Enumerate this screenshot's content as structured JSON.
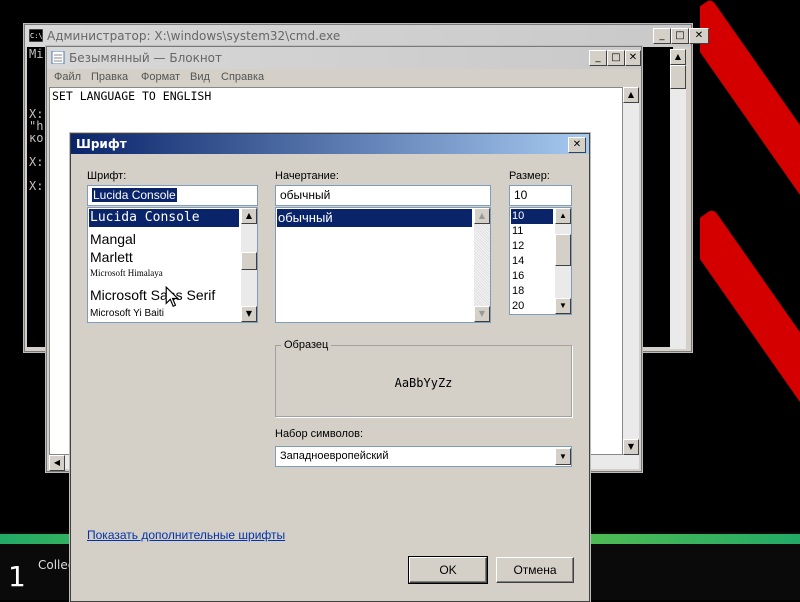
{
  "cmd": {
    "title": "Администратор: X:\\windows\\system32\\cmd.exe",
    "lines": [
      "Mi",
      "X:",
      "\"h",
      "ко",
      "X:",
      "X:"
    ]
  },
  "notepad": {
    "title": "Безымянный — Блокнот",
    "menu": [
      "Файл",
      "Правка",
      "Формат",
      "Вид",
      "Справка"
    ],
    "text": "SET LANGUAGE TO ENGLISH"
  },
  "dialog": {
    "title": "Шрифт",
    "font_label": "Шрифт:",
    "font_value": "Lucida Console",
    "fonts": [
      "Lucida Console",
      "Mangal",
      "Marlett",
      "Microsoft Himalaya",
      "Microsoft Sans Serif",
      "Microsoft Yi Baiti"
    ],
    "style_label": "Начертание:",
    "style_value": "обычный",
    "styles": [
      "обычный"
    ],
    "size_label": "Размер:",
    "size_value": "10",
    "sizes": [
      "10",
      "11",
      "12",
      "14",
      "16",
      "18",
      "20"
    ],
    "sample_label": "Образец",
    "sample_text": "AaBbYyZz",
    "charset_label": "Набор символов:",
    "charset_value": "Западноевропейский",
    "more_fonts_link": "Показать дополнительные шрифты",
    "ok_label": "OK",
    "cancel_label": "Отмена"
  },
  "taskbar": {
    "number": "1",
    "text": "Collec"
  },
  "icons": {
    "minimize": "minimize-icon",
    "maximize": "maximize-icon",
    "close": "close-icon",
    "scroll_up": "arrow-up-icon",
    "scroll_down": "arrow-down-icon",
    "dropdown": "chevron-down-icon",
    "cursor": "mouse-cursor-icon"
  },
  "colors": {
    "selection": "#0a246a",
    "titlebar_active": "#0a246a",
    "window_face": "#d4d0c8",
    "desktop_accent": "#d40000"
  }
}
